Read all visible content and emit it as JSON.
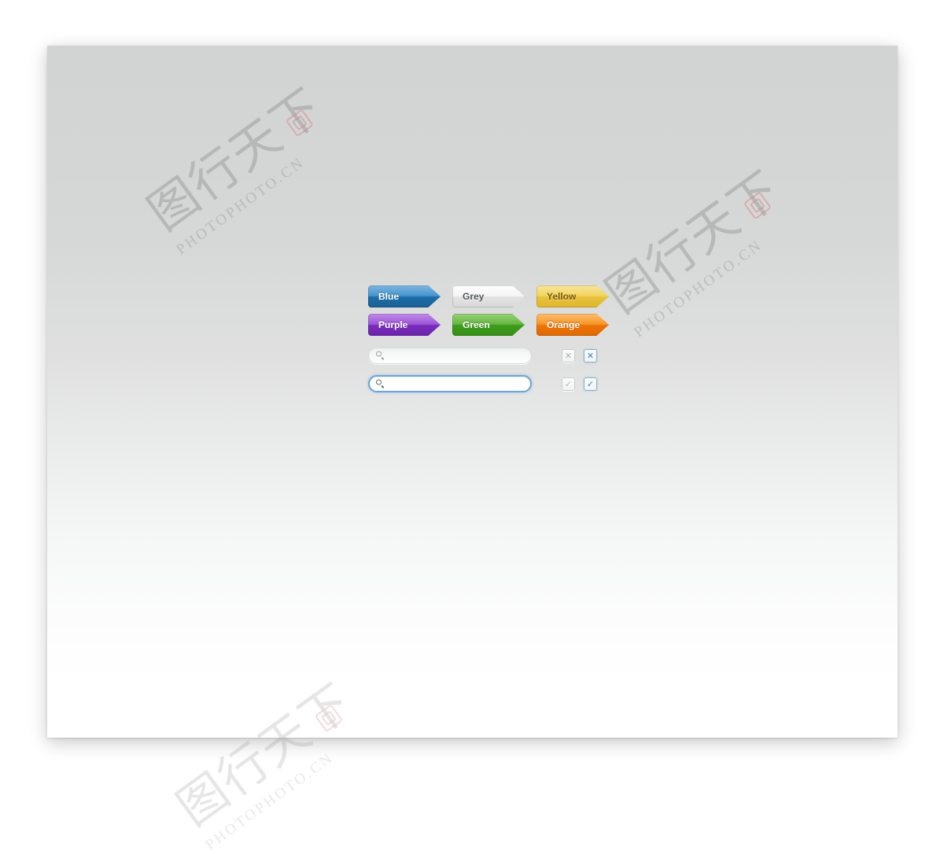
{
  "canvas": {
    "background_top": "#d2d4d4",
    "background_bottom": "#ffffff"
  },
  "watermark": {
    "text": "PHOTOPHOTO.CN",
    "glyphs": "图行天下",
    "stamp_icon": "seal-stamp-icon"
  },
  "buttons": {
    "row1": [
      {
        "label": "Blue",
        "variant": "blue",
        "text_color": "#ffffff",
        "fill": "#2b7cb8"
      },
      {
        "label": "Grey",
        "variant": "grey",
        "text_color": "#555a5d",
        "fill": "#eceded"
      },
      {
        "label": "Yellow",
        "variant": "yellow",
        "text_color": "#7a5c10",
        "fill": "#ebcb4a"
      }
    ],
    "row2": [
      {
        "label": "Purple",
        "variant": "purple",
        "text_color": "#ffffff",
        "fill": "#8a3fcb"
      },
      {
        "label": "Green",
        "variant": "green",
        "text_color": "#ffffff",
        "fill": "#4ea62a"
      },
      {
        "label": "Orange",
        "variant": "orange",
        "text_color": "#ffffff",
        "fill": "#f28212"
      }
    ]
  },
  "search_fields": [
    {
      "state": "default",
      "value": "",
      "placeholder": "",
      "icon": "magnifier-icon",
      "border_color": "#d7d9d9"
    },
    {
      "state": "focused",
      "value": "",
      "placeholder": "",
      "icon": "magnifier-icon",
      "border_color": "#6aa6da"
    }
  ],
  "checkboxes": {
    "row1": [
      {
        "mark": "✕",
        "icon": "cross-icon",
        "state": "default",
        "checked": true,
        "color": "#a8adae"
      },
      {
        "mark": "✕",
        "icon": "cross-icon",
        "state": "focused",
        "checked": true,
        "color": "#3d83c4"
      }
    ],
    "row2": [
      {
        "mark": "✓",
        "icon": "check-icon",
        "state": "default",
        "checked": true,
        "color": "#b0b5b6"
      },
      {
        "mark": "✓",
        "icon": "check-icon",
        "state": "focused",
        "checked": true,
        "color": "#3d83c4"
      }
    ]
  }
}
